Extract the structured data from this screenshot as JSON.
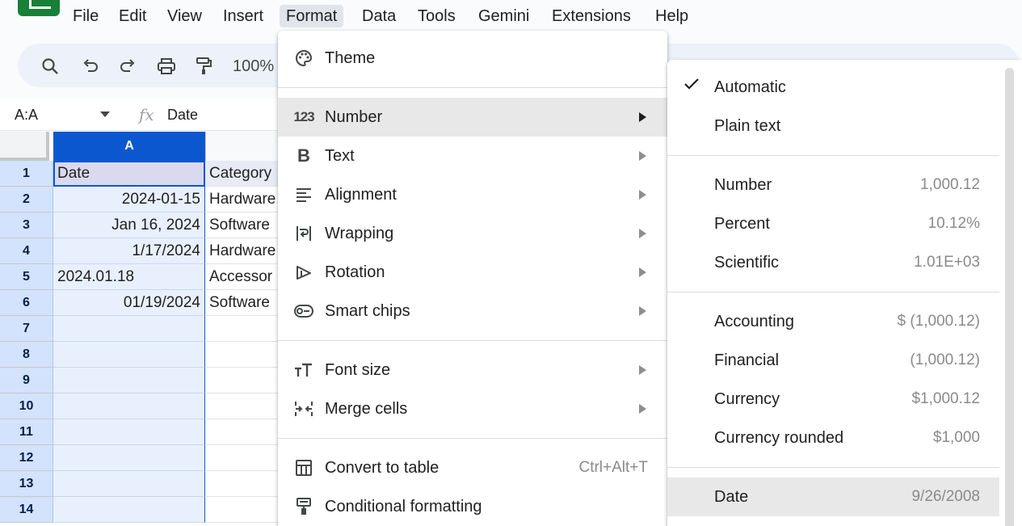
{
  "menubar": {
    "items": [
      "File",
      "Edit",
      "View",
      "Insert",
      "Format",
      "Data",
      "Tools",
      "Gemini",
      "Extensions",
      "Help"
    ],
    "active": "Format"
  },
  "toolbar": {
    "zoom": "100%",
    "icons": [
      "search-icon",
      "undo-icon",
      "redo-icon",
      "print-icon",
      "paint-format-icon"
    ]
  },
  "formula_bar": {
    "namebox": "A:A",
    "fx": "fx",
    "value": "Date"
  },
  "grid": {
    "columns": [
      "A"
    ],
    "rows": [
      {
        "num": "1",
        "a": "Date",
        "b": "Category"
      },
      {
        "num": "2",
        "a": "2024-01-15",
        "b": "Hardware"
      },
      {
        "num": "3",
        "a": "Jan 16, 2024",
        "b": "Software"
      },
      {
        "num": "4",
        "a": "1/17/2024",
        "b": "Hardware"
      },
      {
        "num": "5",
        "a": "2024.01.18",
        "b": "Accessor"
      },
      {
        "num": "6",
        "a": "01/19/2024",
        "b": "Software"
      },
      {
        "num": "7",
        "a": "",
        "b": ""
      },
      {
        "num": "8",
        "a": "",
        "b": ""
      },
      {
        "num": "9",
        "a": "",
        "b": ""
      },
      {
        "num": "10",
        "a": "",
        "b": ""
      },
      {
        "num": "11",
        "a": "",
        "b": ""
      },
      {
        "num": "12",
        "a": "",
        "b": ""
      },
      {
        "num": "13",
        "a": "",
        "b": ""
      },
      {
        "num": "14",
        "a": "",
        "b": ""
      }
    ]
  },
  "format_menu": {
    "theme": "Theme",
    "number": "Number",
    "number_icon": "123",
    "text": "Text",
    "alignment": "Alignment",
    "wrapping": "Wrapping",
    "rotation": "Rotation",
    "smart_chips": "Smart chips",
    "font_size": "Font size",
    "merge_cells": "Merge cells",
    "convert_to_table": "Convert to table",
    "convert_shortcut": "Ctrl+Alt+T",
    "conditional_formatting": "Conditional formatting"
  },
  "number_submenu": {
    "automatic": "Automatic",
    "plain_text": "Plain text",
    "number": "Number",
    "number_ex": "1,000.12",
    "percent": "Percent",
    "percent_ex": "10.12%",
    "scientific": "Scientific",
    "scientific_ex": "1.01E+03",
    "accounting": "Accounting",
    "accounting_ex": "$ (1,000.12)",
    "financial": "Financial",
    "financial_ex": "(1,000.12)",
    "currency": "Currency",
    "currency_ex": "$1,000.12",
    "currency_rounded": "Currency rounded",
    "currency_rounded_ex": "$1,000",
    "date": "Date",
    "date_ex": "9/26/2008"
  },
  "colors": {
    "selection_blue": "#0b57d0",
    "selected_fill": "#e8f0fe",
    "brand_green": "#188038"
  }
}
